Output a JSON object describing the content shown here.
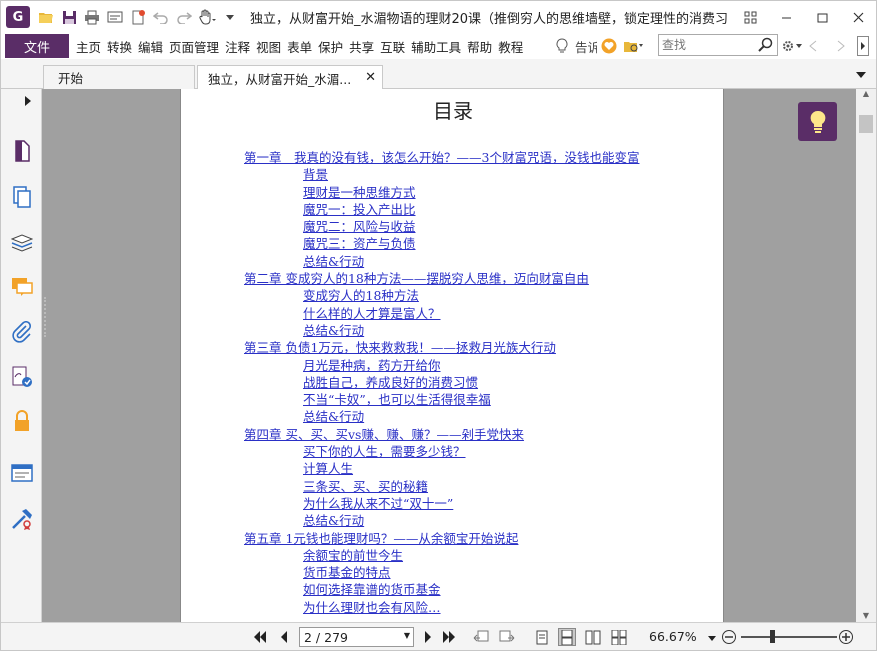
{
  "window": {
    "title": "独立，从财富开始_水湄物语的理财20课（推倒穷人的思维墙壁，锁定理性的消费习惯..."
  },
  "menu": {
    "file": "文件",
    "items": [
      "主页",
      "转换",
      "编辑",
      "页面管理",
      "注释",
      "视图",
      "表单",
      "保护",
      "共享",
      "互联",
      "辅助工具",
      "帮助",
      "教程"
    ],
    "tell_me": "告诉",
    "search_placeholder": "查找"
  },
  "tabs": [
    {
      "label": "开始"
    },
    {
      "label": "独立，从财富开始_水湄..."
    }
  ],
  "document": {
    "heading": "目录",
    "toc": [
      {
        "level": "chap",
        "text": "第一章　我真的没有钱，该怎么开始？——3个财富咒语，没钱也能变富"
      },
      {
        "level": "sec",
        "text": "背景"
      },
      {
        "level": "sec",
        "text": "理财是一种思维方式"
      },
      {
        "level": "sec",
        "text": "魔咒一：投入产出比"
      },
      {
        "level": "sec",
        "text": "魔咒二：风险与收益"
      },
      {
        "level": "sec",
        "text": "魔咒三：资产与负债"
      },
      {
        "level": "sec",
        "text": "总结&行动"
      },
      {
        "level": "chap",
        "text": "第二章 变成穷人的18种方法——摆脱穷人思维，迈向财富自由"
      },
      {
        "level": "sec",
        "text": "变成穷人的18种方法"
      },
      {
        "level": "sec",
        "text": "什么样的人才算是富人？"
      },
      {
        "level": "sec",
        "text": "总结&行动"
      },
      {
        "level": "chap",
        "text": "第三章 负债1万元，快来救救我！——拯救月光族大行动"
      },
      {
        "level": "sec",
        "text": "月光是种病，药方开给你"
      },
      {
        "level": "sec",
        "text": "战胜自己，养成良好的消费习惯"
      },
      {
        "level": "sec",
        "text": "不当“卡奴”，也可以生活得很幸福"
      },
      {
        "level": "sec",
        "text": "总结&行动"
      },
      {
        "level": "chap",
        "text": "第四章 买、买、买vs赚、赚、赚？——剁手党快来"
      },
      {
        "level": "sec",
        "text": "买下你的人生，需要多少钱？"
      },
      {
        "level": "sec",
        "text": "计算人生"
      },
      {
        "level": "sec",
        "text": "三条买、买、买的秘籍"
      },
      {
        "level": "sec",
        "text": "为什么我从来不过“双十一”"
      },
      {
        "level": "sec",
        "text": "总结&行动"
      },
      {
        "level": "chap",
        "text": "第五章 1元钱也能理财吗？——从余额宝开始说起"
      },
      {
        "level": "sec",
        "text": "余额宝的前世今生"
      },
      {
        "level": "sec",
        "text": "货币基金的特点"
      },
      {
        "level": "sec",
        "text": "如何选择靠谱的货币基金"
      },
      {
        "level": "sec",
        "text": "为什么理财也会有风险…"
      }
    ]
  },
  "status": {
    "page_display": "2 / 279",
    "zoom": "66.67%"
  },
  "colors": {
    "brand": "#5a2d67",
    "link": "#2a30c6",
    "doc_bg": "#a0a0a0"
  }
}
